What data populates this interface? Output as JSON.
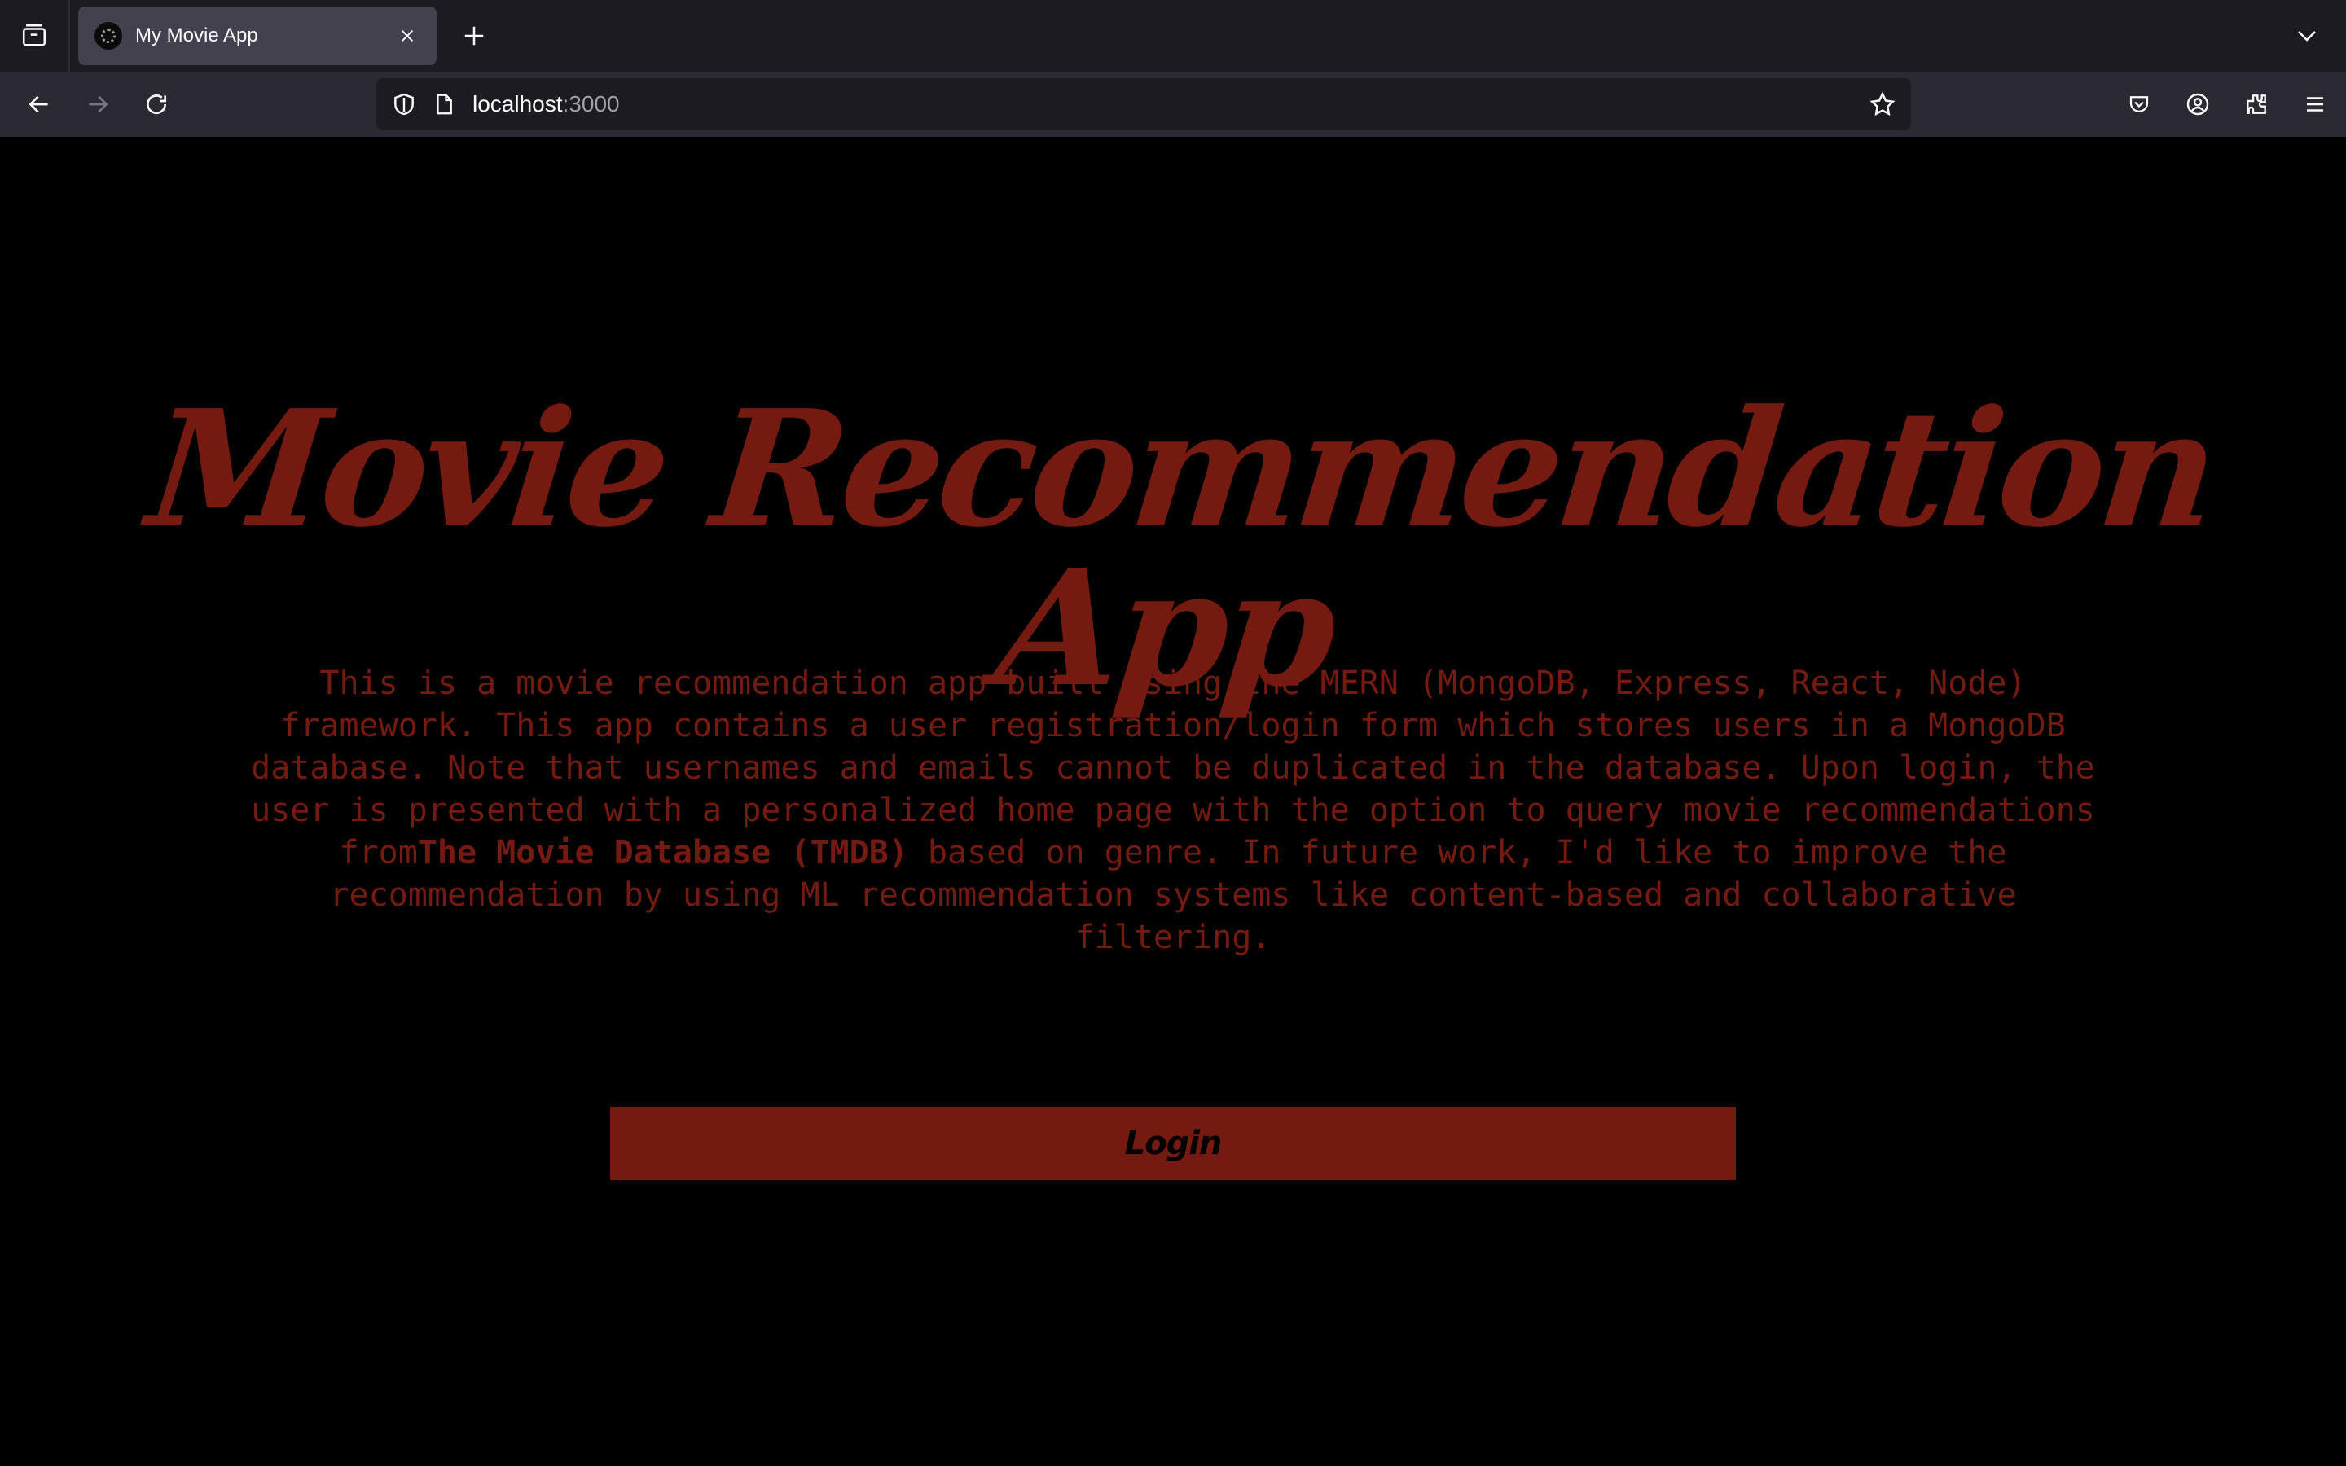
{
  "browser": {
    "tab": {
      "title": "My Movie App"
    },
    "url": {
      "host": "localhost",
      "port": ":3000"
    },
    "icons": [
      "tab-overview-icon",
      "close-icon",
      "plus-icon",
      "chevron-down-icon",
      "back-arrow-icon",
      "forward-arrow-icon",
      "reload-icon",
      "shield-icon",
      "page-icon",
      "star-icon",
      "pocket-icon",
      "account-icon",
      "extensions-icon",
      "menu-icon"
    ]
  },
  "page": {
    "title": "Movie Recommendation App",
    "description": {
      "part1": "This is a movie recommendation app built using the MERN (MongoDB, Express, React, Node) framework. This app contains a user registration/login form which stores users in a MongoDB database. Note that usernames and emails cannot be duplicated in the database. Upon login, the user is presented with a personalized home page with the option to query movie recommendations from",
      "bold": "The Movie Database (TMDB)",
      "part2": " based on genre. In future work, I'd like to improve the recommendation by using ML recommendation systems like content-based and collaborative filtering."
    },
    "login_button": "Login"
  },
  "colors": {
    "accent": "#741a11",
    "background": "#000000",
    "toolbar": "#2b2a33",
    "tabstrip": "#1c1b22"
  }
}
